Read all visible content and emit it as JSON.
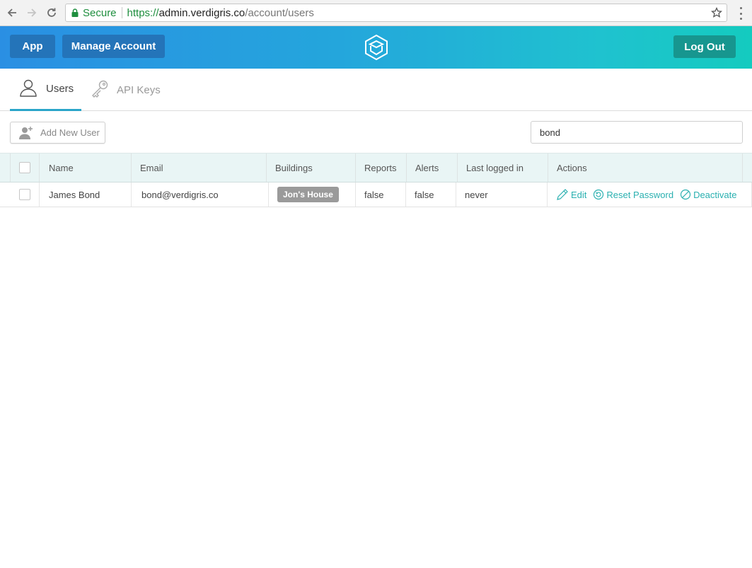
{
  "browser": {
    "secure_label": "Secure",
    "url_scheme": "https://",
    "url_host": "admin.verdigris.co",
    "url_path": "/account/users"
  },
  "header": {
    "app_label": "App",
    "manage_label": "Manage Account",
    "logout_label": "Log Out",
    "colors": {
      "nav_button": "#2474b9",
      "logout_button": "#17968f",
      "gradient_start": "#2a8fe3",
      "gradient_end": "#14cbbf"
    }
  },
  "tabs": [
    {
      "label": "Users",
      "icon": "user-icon",
      "active": true
    },
    {
      "label": "API Keys",
      "icon": "key-icon",
      "active": false
    }
  ],
  "toolbar": {
    "add_user_label": "Add New User",
    "search_value": "bond"
  },
  "table": {
    "columns": [
      "Name",
      "Email",
      "Buildings",
      "Reports",
      "Alerts",
      "Last logged in",
      "Actions"
    ],
    "rows": [
      {
        "name": "James Bond",
        "email": "bond@verdigris.co",
        "building": "Jon's House",
        "reports": "false",
        "alerts": "false",
        "last_logged_in": "never",
        "actions": [
          "Edit",
          "Reset Password",
          "Deactivate"
        ]
      }
    ]
  }
}
